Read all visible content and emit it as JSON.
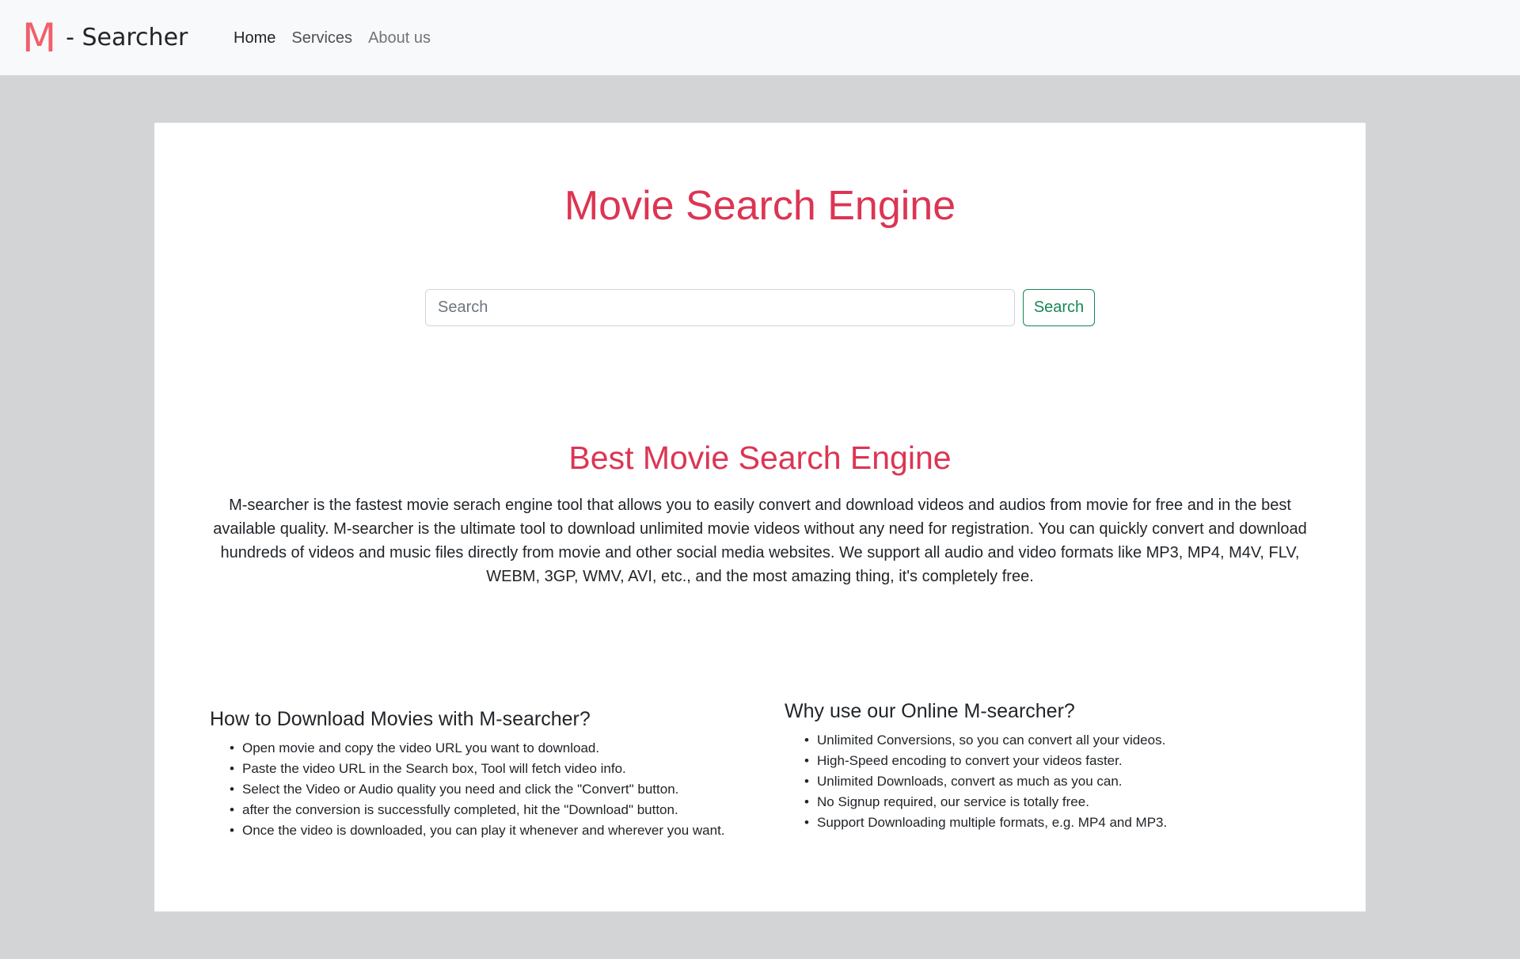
{
  "brand": {
    "logo_letter": "M",
    "text": "- Searcher",
    "logo_color": "#f0606b"
  },
  "nav": {
    "items": [
      {
        "label": "Home"
      },
      {
        "label": "Services"
      },
      {
        "label": "About us"
      }
    ]
  },
  "hero": {
    "title": "Movie Search Engine",
    "title_color": "#dc3553"
  },
  "search": {
    "placeholder": "Search",
    "value": "",
    "button_label": "Search",
    "button_color": "#198754"
  },
  "about": {
    "title": "Best Movie Search Engine",
    "body": "M-searcher is the fastest movie serach engine tool that allows you to easily convert and download videos and audios from movie for free and in the best available quality. M-searcher is the ultimate tool to download unlimited movie videos without any need for registration. You can quickly convert and download hundreds of videos and music files directly from movie and other social media websites. We support all audio and video formats like MP3, MP4, M4V, FLV, WEBM, 3GP, WMV, AVI, etc., and the most amazing thing, it's completely free."
  },
  "howto": {
    "title": "How to Download Movies with M-searcher?",
    "items": [
      "Open movie and copy the video URL you want to download.",
      "Paste the video URL in the Search box, Tool will fetch video info.",
      "Select the Video or Audio quality you need and click the \"Convert\" button.",
      "after the conversion is successfully completed, hit the \"Download\" button.",
      "Once the video is downloaded, you can play it whenever and wherever you want."
    ]
  },
  "why": {
    "title": "Why use our Online M-searcher?",
    "items": [
      "Unlimited Conversions, so you can convert all your videos.",
      "High-Speed encoding to convert your videos faster.",
      "Unlimited Downloads, convert as much as you can.",
      "No Signup required, our service is totally free.",
      "Support Downloading multiple formats, e.g. MP4 and MP3."
    ]
  }
}
